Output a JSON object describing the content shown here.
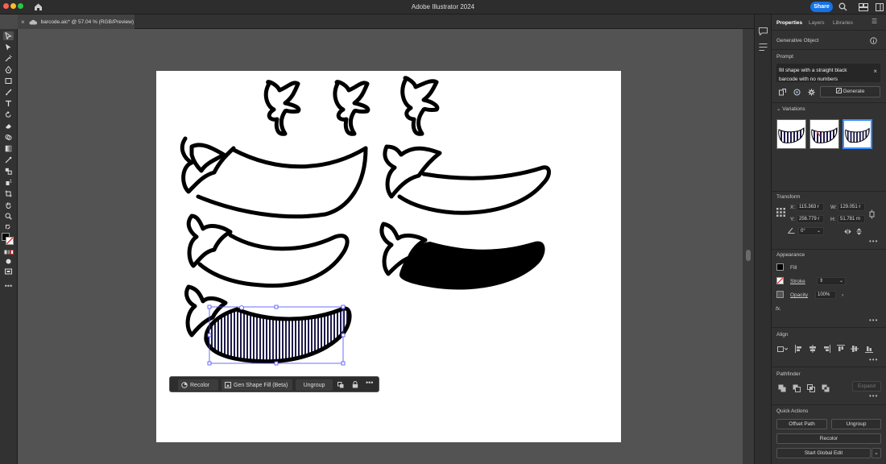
{
  "app": {
    "title": "Adobe Illustrator 2024",
    "share_label": "Share"
  },
  "document": {
    "tab_label": "barcode.aic* @ 57.04 % (RGB/Preview)"
  },
  "context_bar": {
    "recolor": "Recolor",
    "gen_shape_fill": "Gen Shape Fill (Beta)",
    "ungroup": "Ungroup"
  },
  "panel": {
    "tabs": [
      "Properties",
      "Layers",
      "Libraries"
    ],
    "object_type": "Generative Object",
    "prompt_header": "Prompt",
    "prompt_text": "fill shape with a straight black barcode with no numbers",
    "generate_label": "Generate",
    "variations_header": "Variations",
    "transform_header": "Transform",
    "transform": {
      "x_label": "X:",
      "x": "115.363 r",
      "w_label": "W:",
      "w": "129.051 r",
      "y_label": "Y:",
      "y": "256.779 r",
      "h_label": "H:",
      "h": "51.781 m",
      "angle": "0°"
    },
    "appearance_header": "Appearance",
    "fill_label": "Fill",
    "stroke_label": "Stroke",
    "opacity_label": "Opacity",
    "opacity_value": "100%",
    "fx_label": "fx.",
    "align_header": "Align",
    "pathfinder_header": "Pathfinder",
    "expand_label": "Expand",
    "quick_actions_header": "Quick Actions",
    "offset_path": "Offset Path",
    "qa_ungroup": "Ungroup",
    "qa_recolor": "Recolor",
    "start_global_edit": "Start Global Edit"
  },
  "colors": {
    "accent": "#1473e6",
    "selection": "#3d3dff"
  }
}
